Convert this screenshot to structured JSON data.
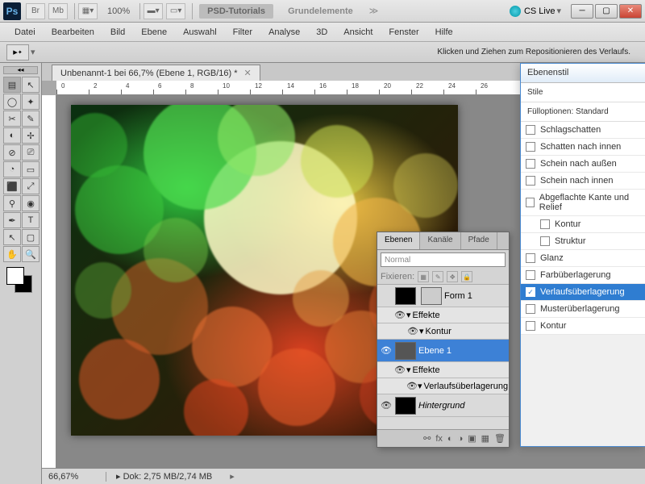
{
  "titlebar": {
    "app": "Ps",
    "zoom": "100%",
    "tags": [
      {
        "label": "PSD-Tutorials",
        "active": true
      },
      {
        "label": "Grundelemente",
        "active": false
      }
    ],
    "cslive": "CS Live"
  },
  "menu": [
    "Datei",
    "Bearbeiten",
    "Bild",
    "Ebene",
    "Auswahl",
    "Filter",
    "Analyse",
    "3D",
    "Ansicht",
    "Fenster",
    "Hilfe"
  ],
  "optionbar": {
    "message": "Klicken und Ziehen zum Repositionieren des Verlaufs."
  },
  "doctab": {
    "title": "Unbenannt-1 bei 66,7% (Ebene 1, RGB/16) *"
  },
  "ruler_marks": [
    0,
    2,
    4,
    6,
    8,
    10,
    12,
    14,
    16,
    18,
    20,
    22,
    24,
    26
  ],
  "status": {
    "zoom": "66,67%",
    "doc": "Dok: 2,75 MB/2,74 MB"
  },
  "layers_panel": {
    "tabs": [
      "Ebenen",
      "Kanäle",
      "Pfade"
    ],
    "blend": "Normal",
    "lock_label": "Fixieren:",
    "layers": [
      {
        "name": "Form 1",
        "thumb": "#000",
        "mask": true
      },
      {
        "name": "Effekte",
        "sub": true,
        "eye": true
      },
      {
        "name": "Kontur",
        "sub": true,
        "eye": true,
        "deeper": true
      },
      {
        "name": "Ebene 1",
        "thumb": "#555",
        "sel": true,
        "eye": true
      },
      {
        "name": "Effekte",
        "sub": true,
        "eye": true
      },
      {
        "name": "Verlaufsüberlagerung",
        "sub": true,
        "eye": true,
        "deeper": true
      },
      {
        "name": "Hintergrund",
        "thumb": "#000",
        "eye": true,
        "italic": true
      }
    ]
  },
  "styles_panel": {
    "title": "Ebenenstil",
    "head1": "Stile",
    "head2": "Fülloptionen: Standard",
    "items": [
      {
        "label": "Schlagschatten"
      },
      {
        "label": "Schatten nach innen"
      },
      {
        "label": "Schein nach außen"
      },
      {
        "label": "Schein nach innen"
      },
      {
        "label": "Abgeflachte Kante und Relief"
      },
      {
        "label": "Kontur",
        "indent": true
      },
      {
        "label": "Struktur",
        "indent": true
      },
      {
        "label": "Glanz"
      },
      {
        "label": "Farbüberlagerung"
      },
      {
        "label": "Verlaufsüberlagerung",
        "checked": true,
        "sel": true
      },
      {
        "label": "Musterüberlagerung"
      },
      {
        "label": "Kontur"
      }
    ]
  },
  "tools": [
    "▤",
    "↖",
    "◯",
    "✦",
    "✂",
    "✎",
    "◐",
    "✢",
    "⊘",
    "⎚",
    "◔",
    "▭",
    "⬛",
    "⤢",
    "⚲",
    "◉",
    "✒",
    "T",
    "↖",
    "▢",
    "✋",
    "🔍"
  ]
}
